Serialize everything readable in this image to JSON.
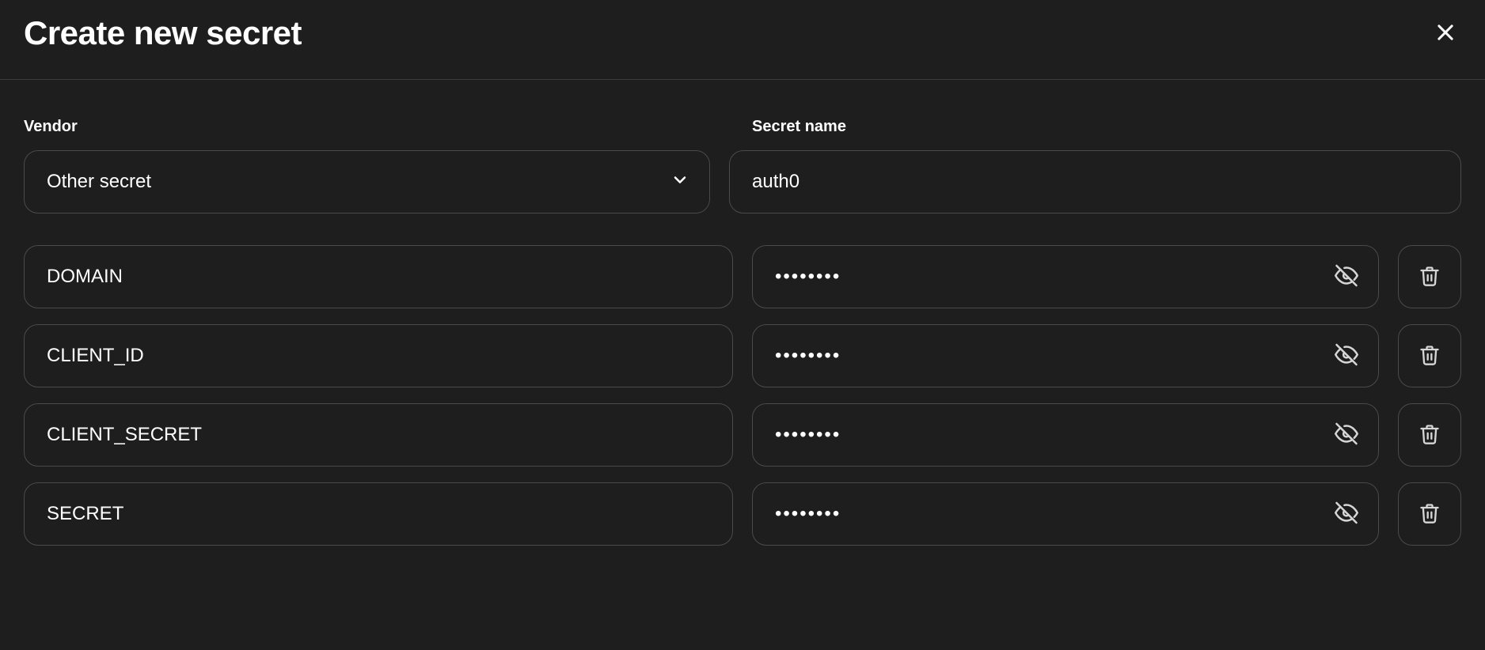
{
  "header": {
    "title": "Create new secret"
  },
  "form": {
    "vendor_label": "Vendor",
    "vendor_value": "Other secret",
    "secret_name_label": "Secret name",
    "secret_name_value": "auth0"
  },
  "rows": [
    {
      "key": "DOMAIN",
      "value_masked": "••••••••"
    },
    {
      "key": "CLIENT_ID",
      "value_masked": "••••••••"
    },
    {
      "key": "CLIENT_SECRET",
      "value_masked": "••••••••"
    },
    {
      "key": "SECRET",
      "value_masked": "••••••••"
    }
  ]
}
